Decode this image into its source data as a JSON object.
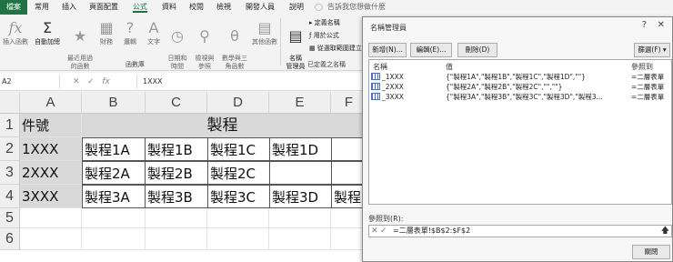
{
  "tabs": [
    "檔案",
    "常用",
    "插入",
    "頁面配置",
    "公式",
    "資料",
    "校閱",
    "檢視",
    "開發人員",
    "說明"
  ],
  "tell_me": "告訴我您想做什麼",
  "ribbon": {
    "insert_function": "插入函數",
    "autosum": "自動加總",
    "recently_used": "最近用過\n的函數",
    "financial": "財務",
    "logical": "邏輯",
    "text": "文字",
    "date_time": "日期和\n時間",
    "lookup_ref": "檢視與\n參照",
    "math_trig": "數學與三\n角函數",
    "more_functions": "其他函數",
    "function_library": "函數庫",
    "name_manager": "名稱\n管理員",
    "define_name": "定義名稱",
    "use_in_formula": "用於公式",
    "create_from_selection": "從選取範圍建立",
    "defined_names": "已定義之名稱"
  },
  "formula_bar": {
    "name_box": "A2",
    "content": "1XXX"
  },
  "sheet": {
    "columns": [
      "A",
      "B",
      "C",
      "D",
      "E",
      "F"
    ],
    "rows": [
      "1",
      "2",
      "3",
      "4",
      "5",
      "6"
    ],
    "a1": "件號",
    "b1": "製程",
    "r2": [
      "1XXX",
      "製程1A",
      "製程1B",
      "製程1C",
      "製程1D"
    ],
    "r3": [
      "2XXX",
      "製程2A",
      "製程2B",
      "製程2C"
    ],
    "r4": [
      "3XXX",
      "製程3A",
      "製程3B",
      "製程3C",
      "製程3D",
      "製程"
    ]
  },
  "dialog": {
    "title": "名稱管理員",
    "help": "?",
    "close": "✕",
    "new_btn": "新增(N)...",
    "edit_btn": "編輯(E)...",
    "delete_btn": "刪除(D)",
    "filter_btn": "篩選(F)",
    "col_name": "名稱",
    "col_value": "值",
    "col_refers": "參照到",
    "names": [
      {
        "name": "_1XXX",
        "value": "{\"製程1A\",\"製程1B\",\"製程1C\",\"製程1D\",\"\"}",
        "refers": "=二層表單"
      },
      {
        "name": "_2XXX",
        "value": "{\"製程2A\",\"製程2B\",\"製程2C\",\"\",\"\"}",
        "refers": "=二層表單"
      },
      {
        "name": "_3XXX",
        "value": "{\"製程3A\",\"製程3B\",\"製程3C\",\"製程3D\",\"製程3...",
        "refers": "=二層表單"
      }
    ],
    "refers_label": "參照到(R):",
    "refers_value": "=二層表單!$B$2:$F$2",
    "close_btn": "關閉"
  }
}
